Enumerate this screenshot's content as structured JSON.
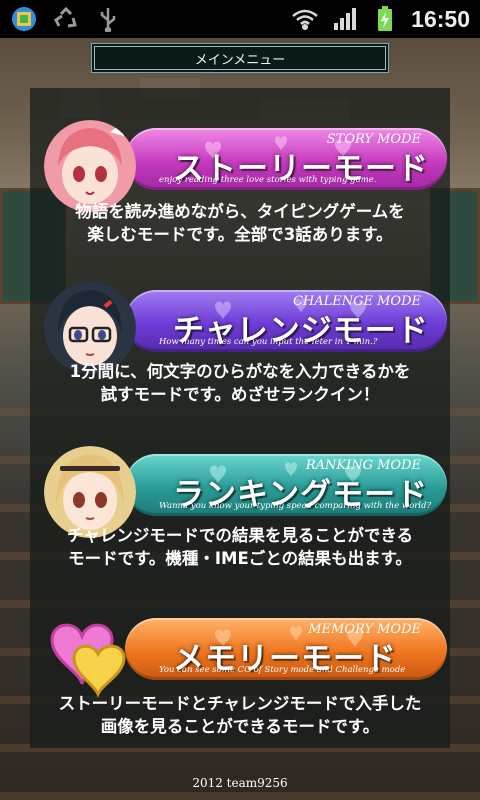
{
  "status_bar": {
    "time": "16:50",
    "icons": [
      "app-icon",
      "recycle-icon",
      "usb-icon",
      "wifi-icon",
      "signal-icon",
      "battery-charging-icon"
    ]
  },
  "header": {
    "title": "メインメニュー"
  },
  "modes": [
    {
      "id": "story",
      "title_jp": "ストーリーモード",
      "title_en": "STORY MODE",
      "subtitle": "enjoy reading three love stories with typing game.",
      "description_line1": "物語を読み進めながら、タイピングゲームを",
      "description_line2": "楽しむモードです。全部で3話あります。",
      "color": "#c63bbf"
    },
    {
      "id": "challenge",
      "title_jp": "チャレンジモード",
      "title_en": "CHALENGE MODE",
      "subtitle": "How many times can you input the leter in  1 min.?",
      "description_line1": "1分間に、何文字のひらがなを入力できるかを",
      "description_line2": "試すモードです。めざせランクイン！",
      "color": "#6e3cd8"
    },
    {
      "id": "ranking",
      "title_jp": "ランキングモード",
      "title_en": "RANKING MODE",
      "subtitle": "Wanna you know  your typing spead comparing with the world?",
      "description_line1": "チャレンジモードでの結果を見ることができる",
      "description_line2": "モードです。機種・IMEごとの結果も出ます。",
      "color": "#2a9c97"
    },
    {
      "id": "memory",
      "title_jp": "メモリーモード",
      "title_en": "MEMORY MODE",
      "subtitle": "You can see some CG of Story mode and Challenge mode",
      "description_line1": "ストーリーモードとチャレンジモードで入手した",
      "description_line2": "画像を見ることができるモードです。",
      "color": "#f0761f"
    }
  ],
  "footer": {
    "copyright": "2012  team9256"
  }
}
